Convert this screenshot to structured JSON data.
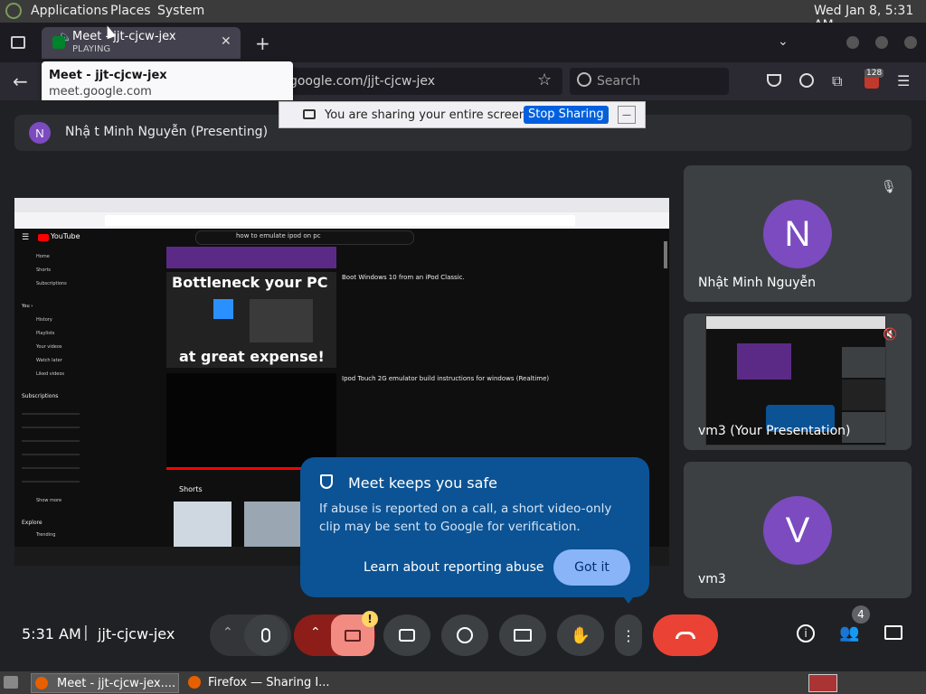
{
  "system_bar": {
    "applications": "Applications",
    "places": "Places",
    "system": "System",
    "clock": "Wed Jan  8,  5:31 AM"
  },
  "browser": {
    "tab_title": "Meet - jjt-cjcw-jex",
    "tab_status": "PLAYING",
    "tooltip_title": "Meet - jjt-cjcw-jex",
    "tooltip_domain": "meet.google.com",
    "url_text": "t.google.com/jjt-cjcw-jex",
    "search_placeholder": "Search",
    "extension_badge": "128"
  },
  "share_banner": {
    "text": "You are sharing your entire screen.",
    "stop_label": "Stop Sharing",
    "hide_label": "—"
  },
  "presenting_bar": {
    "avatar_letter": "N",
    "label": "Nhậ t Minh Nguyễn (Presenting)"
  },
  "shared_screen": {
    "yt_logo": "YouTube",
    "search_query": "how to emulate ipod on pc",
    "sidebar_items": [
      "Home",
      "Shorts",
      "Subscriptions",
      "You ›",
      "History",
      "Playlists",
      "Your videos",
      "Watch later",
      "Liked videos",
      "Subscriptions",
      "Show more",
      "Explore",
      "Trending"
    ],
    "thumb_text_top": "Bottleneck your PC",
    "thumb_text_bottom": "at great expense!",
    "video1_title": "Boot Windows 10 from an iPod Classic.",
    "video2_title": "Ipod Touch 2G emulator build instructions for windows (Realtime)",
    "shorts_label": "Shorts"
  },
  "participants": [
    {
      "letter": "N",
      "name": "Nhật Minh Nguyễn",
      "color": "#7b4bbf"
    },
    {
      "name": "vm3 (Your Presentation)"
    },
    {
      "letter": "V",
      "name": "vm3",
      "color": "#7b4bbf"
    }
  ],
  "safe_popup": {
    "title": "Meet keeps you safe",
    "body": "If abuse is reported on a call, a short video-only clip may be sent to Google for verification.",
    "learn_link": "Learn about reporting abuse",
    "got_it": "Got it"
  },
  "control_bar": {
    "time": "5:31 AM",
    "separator": "|",
    "meeting_code": "jjt-cjcw-jex",
    "people_count": "4",
    "warning_mark": "!"
  },
  "taskbar": {
    "item1": "Meet - jjt-cjcw-jex....",
    "item2": "Firefox — Sharing I..."
  },
  "colors": {
    "accent_blue": "#8ab4f8",
    "popup_bg": "#0b5394",
    "end_call": "#ea4335",
    "avatar_purple": "#7b4bbf"
  }
}
